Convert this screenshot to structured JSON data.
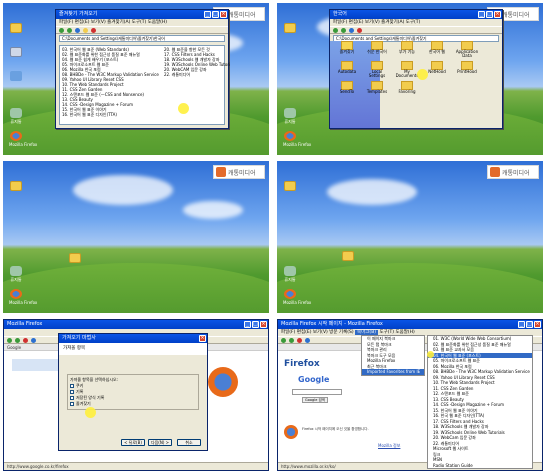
{
  "logo": {
    "text": "캐통미디어"
  },
  "desktop_icons": {
    "recycle": "휴지통",
    "firefox": "Mozilla Firefox"
  },
  "frame1": {
    "window_title": "즐겨찾기 가져오기",
    "menu": "파일(F)  편집(E)  보기(V)  즐겨찾기(A)  도구(T)  도움말(H)",
    "address": "C:\\Documents and Settings\\캐통미디어\\즐겨찾기\\한국어",
    "left_items": [
      "03. 한국어 웹 표준 (Web Standards)",
      "02. 웹 표준화를 위한 접근성 품질 표준 매뉴얼",
      "04. 웹 표준 쉽게 배우기 (포스트)",
      "05. 마이크로소프트 웹 표준",
      "06. Mozilla 한국 포럼",
      "08. BHBDe - The W3C Markup Validation Service",
      "09. Yahoo UI Library Reset CSS",
      "10. The Web Standards Project",
      "11. CSS Zen Garden",
      "12. 스탠포드 웹 표준 (—CSS and Nonsence)",
      "13. CSS Beauty",
      "14. CSS -Design Magazine + Forum",
      "15. 한국어 웹 표준 이야기",
      "16. 한국어 웹 표준 디자인(TTA)"
    ],
    "right_items": [
      "20. 웹 표준을 향한 모든 것",
      "17. CSS Filters and Hacks",
      "18. W3Schools 웹 개발자 강좌",
      "19. W3Schools Online Web Tutorials",
      "20. WebCAM 입문 강좌",
      "22. 캐통미디어"
    ]
  },
  "frame2": {
    "window_title": "한국어",
    "menu": "파일(F)  편집(E)  보기(V)  즐겨찾기(A)  도구(T)",
    "address": "C:\\Documents and Settings\\캐통미디어\\즐겨찾기",
    "icons": [
      "즐겨찾기",
      "쉬운 한국어",
      "부가 기능",
      "한국어 웹",
      "Application Data",
      "Autodata",
      "Local Settings",
      "My Documents",
      "NetHood",
      "PrintHood",
      "SendTo",
      "Templates",
      "Favoring"
    ]
  },
  "frame5": {
    "window_title": "Mozilla Firefox",
    "tab": "Google",
    "dialog_title": "가져오기 마법사",
    "dialog_heading": "가져올 항목",
    "dialog_sub": "가져올 항목을 선택하십시오:",
    "options": [
      "쿠키",
      "기록",
      "저장된 양식 기록",
      "즐겨찾기"
    ],
    "buttons": [
      "< 뒤로(B)",
      "다음(N) >",
      "취소"
    ],
    "status": "http://www.google.co.kr/firefox"
  },
  "frame6": {
    "window_title": "Mozilla Firefox 시작 페이지 - Mozilla Firefox",
    "menu": [
      "파일(F)",
      "편집(E)",
      "보기(V)",
      "방문 기록(S)",
      "북마크(B)",
      "도구(T)",
      "도움말(H)"
    ],
    "active_menu": "북마크(B)",
    "bookmark_menu": [
      "이 페이지 북마크",
      "모든 탭 북마크",
      "북마크 관리",
      "북마크 도구 모음",
      "Mozilla Firefox",
      "최근 북마크",
      "Imported Favorites from IE"
    ],
    "submenu": [
      "01. W3C (World Wide Web Consortium)",
      "02. 웹 표준화를 위한 접근성 품질 표준 매뉴얼",
      "03. 웹 표준 교과서 모음",
      "04. 한국어 웹 표준 (포스트)",
      "05. 마이크로소프트 웹 표준",
      "06. Mozilla 한국 포럼",
      "08. BHBDe - The W3C Markup Validation Service",
      "09. Yahoo UI Library Reset CSS",
      "10. The Web Standards Project",
      "11. CSS Zen Garden",
      "12. 스탠포드 웹 표준",
      "13. CSS Beauty",
      "14. CSS -Design Magazine + Forum",
      "15. 한국어 웹 표준 이야기",
      "16. 한국 웹 표준 디자인(TTA)",
      "17. CSS Filters and Hacks",
      "18. W3Schools 웹 개발자 강좌",
      "19. W3Schools Online Web Tutorials",
      "20. WebCam 입문 강좌",
      "22. 캐통미디어",
      "Microsoft 웹 사이트",
      "링크",
      "MSN",
      "Radio Station Guide"
    ],
    "firefox_label": "Firefox",
    "google_label": "Google",
    "search_btn": "Google 검색",
    "footer": "Firefox 시작 페이지에 오신 것을 환영합니다.",
    "about": "Mozilla 정보",
    "status": "http://www.mozilla.or.kr/ko/"
  }
}
